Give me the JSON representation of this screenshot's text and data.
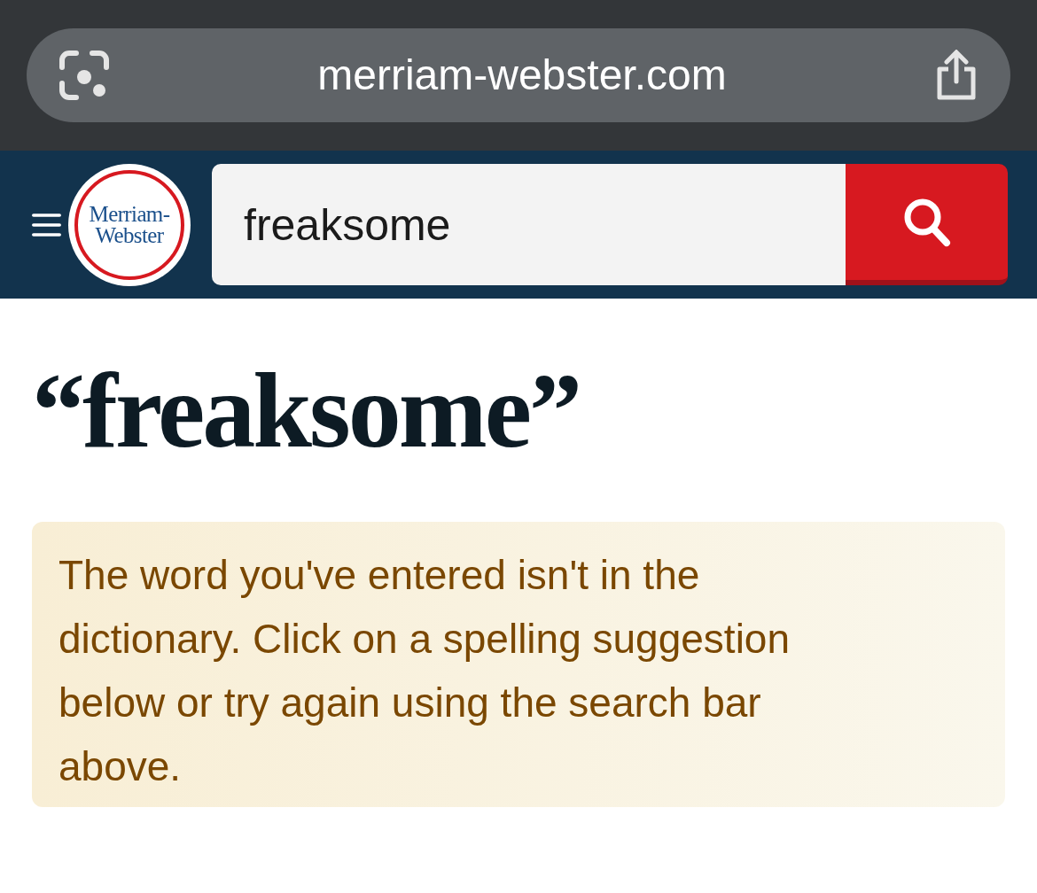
{
  "browser": {
    "url": "merriam-webster.com"
  },
  "header": {
    "logo_text": "Merriam-Webster",
    "search": {
      "value": "freaksome"
    }
  },
  "heading": "“freaksome”",
  "notice": "The word you've entered isn't in the dictionary. Click on a spelling suggestion below or try again using the search bar above."
}
